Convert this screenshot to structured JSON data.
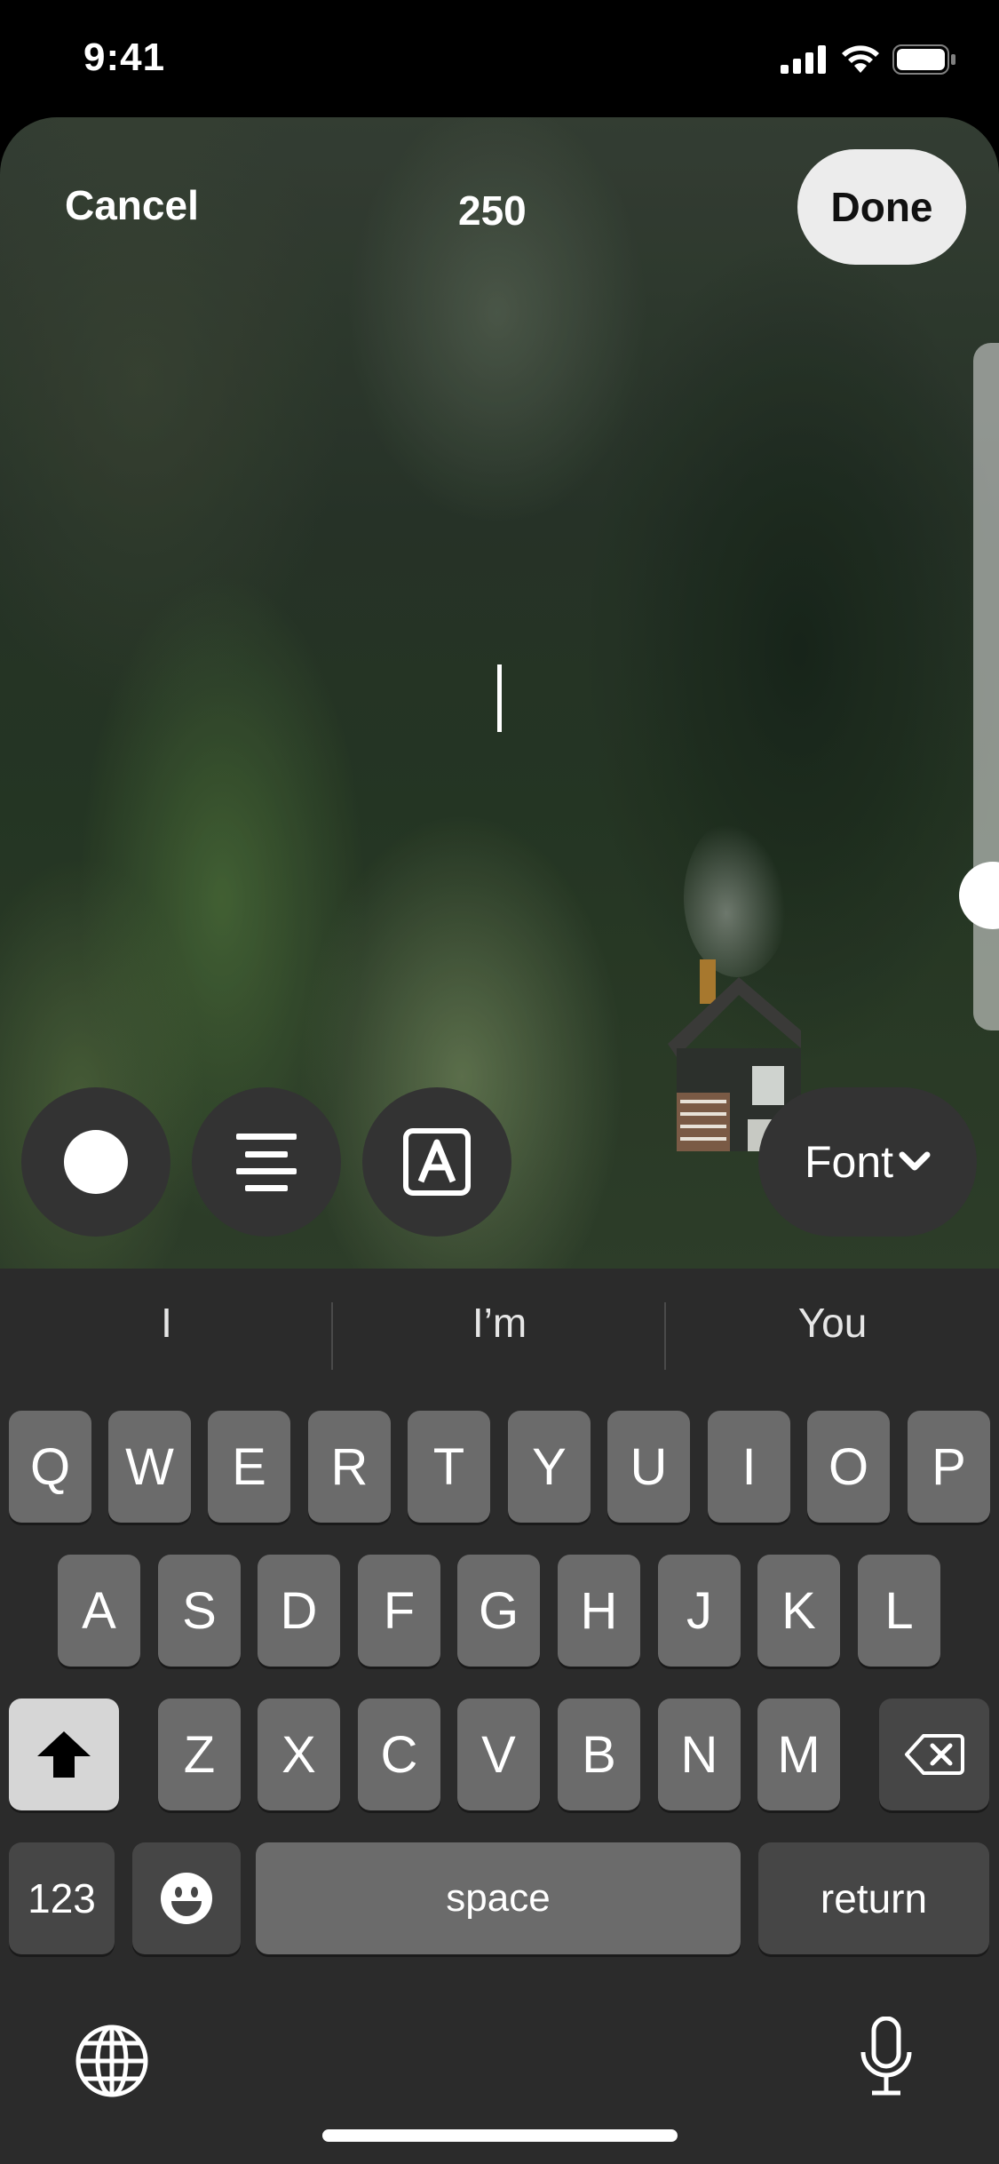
{
  "status_bar": {
    "time": "9:41"
  },
  "editor": {
    "cancel_label": "Cancel",
    "char_count": "250",
    "done_label": "Done",
    "font_label": "Font"
  },
  "keyboard": {
    "suggestions": [
      "I",
      "I’m",
      "You"
    ],
    "row1": [
      "Q",
      "W",
      "E",
      "R",
      "T",
      "Y",
      "U",
      "I",
      "O",
      "P"
    ],
    "row2": [
      "A",
      "S",
      "D",
      "F",
      "G",
      "H",
      "J",
      "K",
      "L"
    ],
    "row3": [
      "Z",
      "X",
      "C",
      "V",
      "B",
      "N",
      "M"
    ],
    "numbers_label": "123",
    "space_label": "space",
    "return_label": "return"
  }
}
